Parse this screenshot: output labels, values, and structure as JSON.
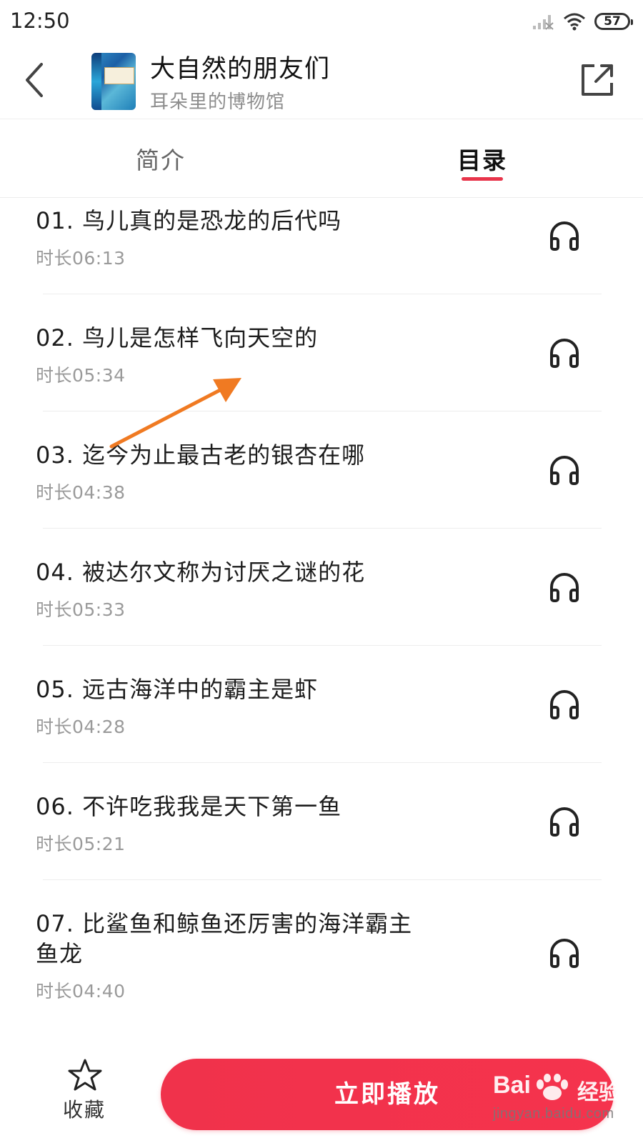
{
  "status_bar": {
    "time": "12:50",
    "battery": "57",
    "icons": [
      "signal-icon",
      "wifi-icon",
      "battery-icon"
    ]
  },
  "header": {
    "title": "大自然的朋友们",
    "subtitle": "耳朵里的博物馆",
    "back_icon": "chevron-left-icon",
    "share_icon": "share-icon"
  },
  "tabs": [
    {
      "label": "简介",
      "active": false
    },
    {
      "label": "目录",
      "active": true
    }
  ],
  "episodes": [
    {
      "title": "01. 鸟儿真的是恐龙的后代吗",
      "duration": "时长06:13"
    },
    {
      "title": "02. 鸟儿是怎样飞向天空的",
      "duration": "时长05:34"
    },
    {
      "title": "03. 迄今为止最古老的银杏在哪",
      "duration": "时长04:38"
    },
    {
      "title": "04. 被达尔文称为讨厌之谜的花",
      "duration": "时长05:33"
    },
    {
      "title": "05. 远古海洋中的霸主是虾",
      "duration": "时长04:28"
    },
    {
      "title": "06. 不许吃我我是天下第一鱼",
      "duration": "时长05:21"
    },
    {
      "title": "07. 比鲨鱼和鲸鱼还厉害的海洋霸主鱼龙",
      "duration": "时长04:40"
    }
  ],
  "bottom_bar": {
    "favorite_label": "收藏",
    "play_label": "立即播放"
  },
  "watermark": {
    "brand": "Bai",
    "brand_cn": "经验",
    "url": "jingyan.baidu.com"
  },
  "colors": {
    "accent": "#f0324b",
    "tab_underline": "#e8344a",
    "annotation_arrow": "#f07a22"
  }
}
